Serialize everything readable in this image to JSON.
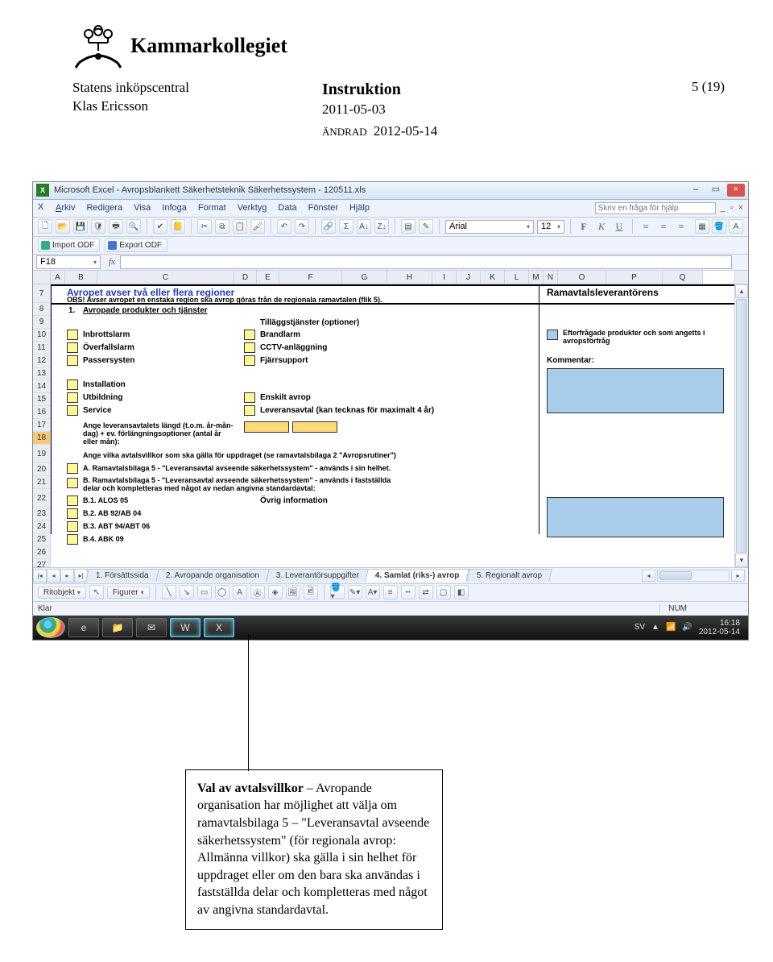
{
  "header": {
    "org": "Kammarkollegiet",
    "dept": "Statens inköpscentral",
    "author": "Klas Ericsson",
    "doc_type": "Instruktion",
    "date": "2011-05-03",
    "andrad_label": "ÄNDRAD",
    "andrad_date": "2012-05-14",
    "page": "5 (19)"
  },
  "excel": {
    "title": "Microsoft Excel - Avropsblankett Säkerhetsteknik Säkerhetssystem - 120511.xls",
    "menu": [
      "Arkiv",
      "Redigera",
      "Visa",
      "Infoga",
      "Format",
      "Verktyg",
      "Data",
      "Fönster",
      "Hjälp"
    ],
    "help_placeholder": "Skriv en fråga för hjälp",
    "import_odf": "Import ODF",
    "export_odf": "Export ODF",
    "font_name": "Arial",
    "font_size": "12",
    "name_box": "F18",
    "columns": [
      "A",
      "B",
      "C",
      "D",
      "E",
      "F",
      "G",
      "H",
      "I",
      "J",
      "K",
      "L",
      "M",
      "N",
      "O",
      "P",
      "Q"
    ],
    "row_numbers": [
      "7",
      "8",
      "9",
      "10",
      "11",
      "12",
      "13",
      "14",
      "15",
      "16",
      "17",
      "18",
      "19",
      "20",
      "21",
      "22",
      "23",
      "24",
      "25",
      "26",
      "27"
    ],
    "selected_row": "18",
    "content": {
      "avropet_title": "Avropet avser två eller flera regioner",
      "obs_line": "OBS! Avser avropet en enstaka region ska avrop göras från de regionala ramavtalen (flik 5).",
      "section1_title": "Avropade produkter och tjänster",
      "section1_num": "1.",
      "left_items": [
        "Inbrottslarm",
        "Överfallslarm",
        "Passersysten",
        "Installation",
        "Utbildning",
        "Service"
      ],
      "tillagg_label": "Tilläggstjänster (optioner)",
      "tillagg_items": [
        "Brandlarm",
        "CCTV-anläggning",
        "Fjärrsupport",
        "Enskilt avrop",
        "Leveransavtal (kan tecknas för maximalt 4 år)"
      ],
      "ange_lev": "Ange leveransavtalets längd (t.o.m. år-mån-dag) + ev. förlängningsoptioner (antal år eller mån):",
      "ange_villkor": "Ange vilka avtalsvillkor som ska gälla för uppdraget  (se ramavtalsbilaga 2 \"Avropsrutiner\")",
      "optA": "A. Ramavtalsbilaga 5 - \"Leveransavtal avseende säkerhetssystem\" - används i sin helhet.",
      "optB": "B. Ramavtalsbilaga 5 - \"Leveransavtal avseende säkerhetssystem\" - används i fastställda delar och kompletteras med något av nedan angivna standardavtal:",
      "b1": "B.1. ALOS 05",
      "b2": "B.2. AB 92/AB 04",
      "b3": "B.3. ABT 94/ABT 06",
      "b4": "B.4. ABK 09",
      "ovrig_info": "Övrig information",
      "ram_title": "Ramavtalsleverantörens",
      "efterfragade": "Efterfrågade produkter och som angetts i avropsförfråg",
      "kommentar": "Kommentar:"
    },
    "tabs": [
      {
        "label": "1. Försättssida",
        "active": false
      },
      {
        "label": "2. Avropande organisation",
        "active": false
      },
      {
        "label": "3. Leverantörsuppgifter",
        "active": false
      },
      {
        "label": "4. Samlat (riks-) avrop",
        "active": true
      },
      {
        "label": "5. Regionalt avrop",
        "active": false
      }
    ],
    "drawbar": {
      "ritobjekt": "Ritobjekt",
      "figurer": "Figurer"
    },
    "status": {
      "ready": "Klar",
      "num": "NUM"
    },
    "taskbar": {
      "lang": "SV",
      "time": "16:18",
      "date": "2012-05-14"
    }
  },
  "callout": {
    "title": "Val av avtalsvillkor",
    "body": " – Avropande organisation har möjlighet att välja om ramavtalsbilaga 5 – \"Leveransavtal avseende säkerhetssystem\" (för regionala avrop: Allmänna villkor) ska gälla i sin helhet för uppdraget eller om den bara ska användas i fastställda delar och kompletteras med något av angivna standardavtal."
  }
}
